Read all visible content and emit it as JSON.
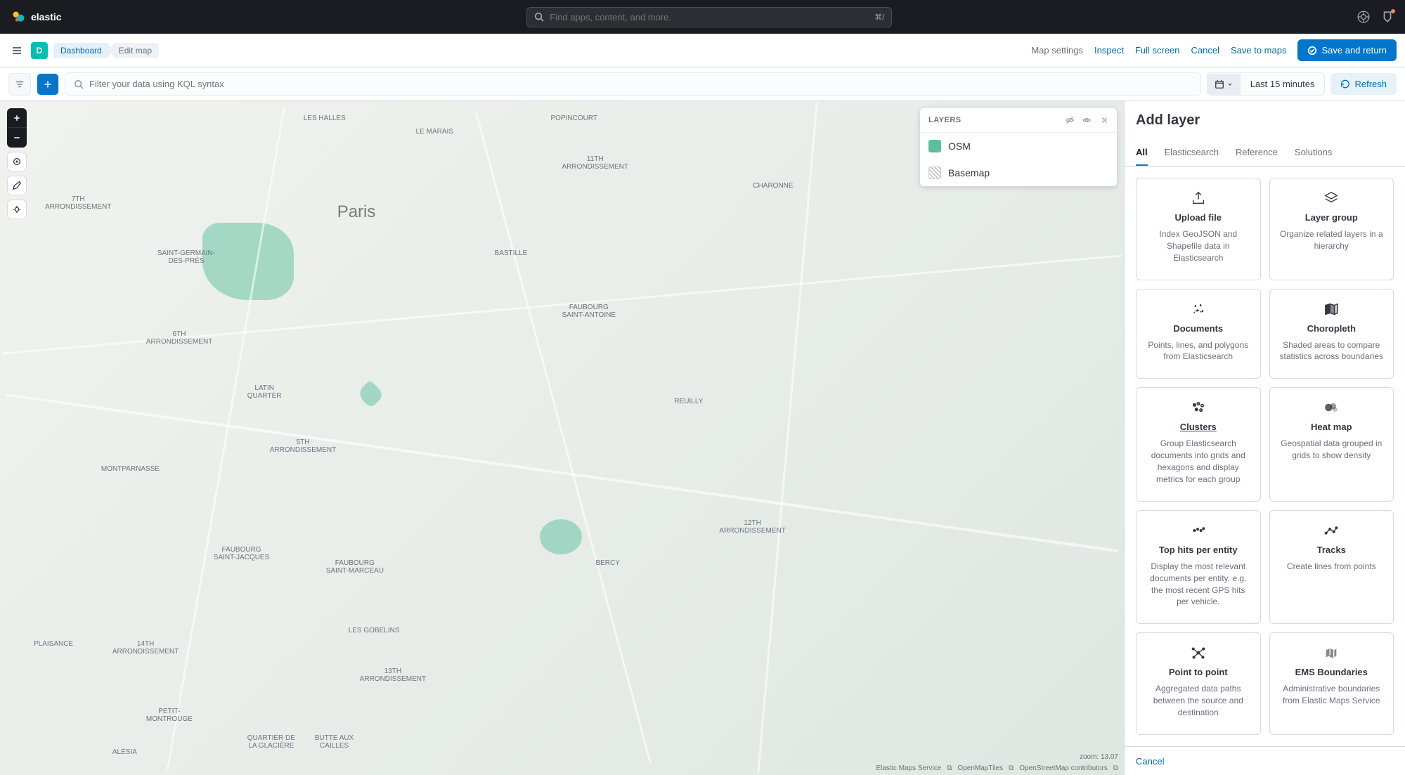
{
  "header": {
    "brand": "elastic",
    "search_placeholder": "Find apps, content, and more.",
    "search_shortcut": "⌘/"
  },
  "subheader": {
    "app_badge": "D",
    "breadcrumbs": {
      "dashboard": "Dashboard",
      "current": "Edit map"
    },
    "actions": {
      "map_settings": "Map settings",
      "inspect": "Inspect",
      "full_screen": "Full screen",
      "cancel": "Cancel",
      "save_to_maps": "Save to maps",
      "save_return": "Save and return"
    }
  },
  "querybar": {
    "kql_placeholder": "Filter your data using KQL syntax",
    "time_label": "Last 15 minutes",
    "refresh": "Refresh"
  },
  "map": {
    "city_label": "Paris",
    "labels": {
      "les_halles": "LES HALLES",
      "le_marais": "LE MARAIS",
      "popincourt": "POPINCOURT",
      "eleventh": "11TH\nARRONDISSEMENT",
      "charonne": "CHARONNE",
      "saint_germain": "SAINT-GERMAIN-\nDES-PRÉS",
      "seventh": "7TH\nARRONDISSEMENT",
      "sixth": "6TH\nARRONDISSEMENT",
      "latin": "LATIN\nQUARTER",
      "bastille": "BASTILLE",
      "faubourg_sa": "FAUBOURG\nSAINT-ANTOINE",
      "reuilly": "REUILLY",
      "fifth": "5TH\nARRONDISSEMENT",
      "montparnasse": "MONTPARNASSE",
      "faubourg_sj": "FAUBOURG\nSAINT-JACQUES",
      "faubourg_sm": "FAUBOURG\nSAINT-MARCEAU",
      "bercy": "BERCY",
      "twelfth": "12TH\nARRONDISSEMENT",
      "plaisance": "PLAISANCE",
      "fourteenth": "14TH\nARRONDISSEMENT",
      "les_gobelins": "LES GOBELINS",
      "thirteenth": "13TH\nARRONDISSEMENT",
      "petit_montrouge": "PETIT-\nMONTROUGE",
      "butte": "BUTTE AUX\nCAILLES",
      "glaciere": "QUARTIER DE\nLA GLACIÈRE",
      "alesia": "ALÉSIA"
    },
    "zoom": "zoom: 13.07",
    "attribution": {
      "ems": "Elastic Maps Service",
      "omt": "OpenMapTiles",
      "osm": "OpenStreetMap contributors"
    }
  },
  "layers_panel": {
    "title": "LAYERS",
    "items": [
      {
        "name": "OSM",
        "swatch": "green"
      },
      {
        "name": "Basemap",
        "swatch": "grid"
      }
    ]
  },
  "right_panel": {
    "title": "Add layer",
    "tabs": {
      "all": "All",
      "elasticsearch": "Elasticsearch",
      "reference": "Reference",
      "solutions": "Solutions"
    },
    "cards": [
      {
        "id": "upload",
        "title": "Upload file",
        "desc": "Index GeoJSON and Shapefile data in Elasticsearch",
        "icon": "upload"
      },
      {
        "id": "group",
        "title": "Layer group",
        "desc": "Organize related layers in a hierarchy",
        "icon": "layers"
      },
      {
        "id": "documents",
        "title": "Documents",
        "desc": "Points, lines, and polygons from Elasticsearch",
        "icon": "documents"
      },
      {
        "id": "choropleth",
        "title": "Choropleth",
        "desc": "Shaded areas to compare statistics across boundaries",
        "icon": "choropleth"
      },
      {
        "id": "clusters",
        "title": "Clusters",
        "desc": "Group Elasticsearch documents into grids and hexagons and display metrics for each group",
        "icon": "clusters",
        "underline": true
      },
      {
        "id": "heatmap",
        "title": "Heat map",
        "desc": "Geospatial data grouped in grids to show density",
        "icon": "heatmap"
      },
      {
        "id": "tophits",
        "title": "Top hits per entity",
        "desc": "Display the most relevant documents per entity, e.g. the most recent GPS hits per vehicle.",
        "icon": "tophits"
      },
      {
        "id": "tracks",
        "title": "Tracks",
        "desc": "Create lines from points",
        "icon": "tracks"
      },
      {
        "id": "p2p",
        "title": "Point to point",
        "desc": "Aggregated data paths between the source and destination",
        "icon": "p2p"
      },
      {
        "id": "ems",
        "title": "EMS Boundaries",
        "desc": "Administrative boundaries from Elastic Maps Service",
        "icon": "ems"
      }
    ],
    "footer_cancel": "Cancel"
  }
}
